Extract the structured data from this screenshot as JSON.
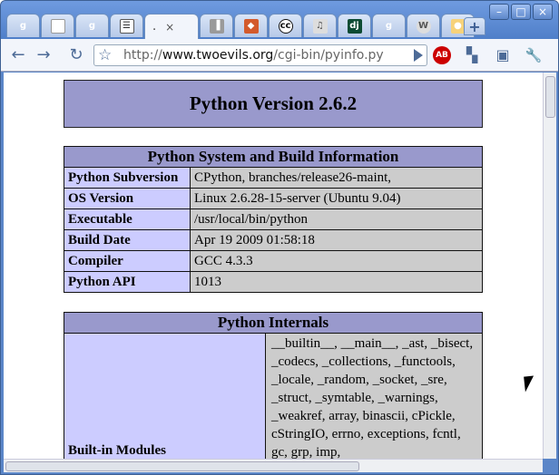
{
  "window": {
    "minimize": "–",
    "maximize": "□",
    "close": "×"
  },
  "tabs": [
    {
      "icon": "google-icon",
      "text": "g",
      "color": "#4285f4"
    },
    {
      "icon": "blank-page-icon",
      "text": "",
      "color": "#cccccc"
    },
    {
      "icon": "google-icon",
      "text": "g",
      "color": "#4285f4"
    },
    {
      "icon": "document-icon",
      "text": "☰",
      "color": "#444444"
    },
    {
      "title": ".",
      "close": "×",
      "active": true
    },
    {
      "icon": "bar-icon",
      "text": "▐",
      "color": "#777777"
    },
    {
      "icon": "face-icon",
      "text": "◆",
      "color": "#d35a2c"
    },
    {
      "icon": "creative-commons-icon",
      "text": "cc",
      "color": "#222222"
    },
    {
      "icon": "ghost-icon",
      "text": "♫",
      "color": "#888888"
    },
    {
      "icon": "django-icon",
      "text": "dj",
      "color": "#0c4b33"
    },
    {
      "icon": "google-icon",
      "text": "g",
      "color": "#4285f4"
    },
    {
      "icon": "wordpress-icon",
      "text": "W",
      "color": "#777777"
    },
    {
      "icon": "gold-circle-icon",
      "text": "●",
      "color": "#f0a23a"
    }
  ],
  "newtab": "+",
  "toolbar": {
    "back": "←",
    "forward": "→",
    "reload": "↻",
    "bookmark": "☆",
    "page_menu": "▣",
    "wrench": "🔧",
    "adblock_badge": "AB"
  },
  "url": {
    "scheme": "http://",
    "host": "www.twoevils.org",
    "path": "/cgi-bin/pyinfo.py"
  },
  "page": {
    "heading": "Python Version 2.6.2",
    "build_info": {
      "title": "Python System and Build Information",
      "rows": [
        {
          "k": "Python Subversion",
          "v": "CPython, branches/release26-maint,"
        },
        {
          "k": "OS Version",
          "v": "Linux 2.6.28-15-server (Ubuntu 9.04)"
        },
        {
          "k": "Executable",
          "v": "/usr/local/bin/python"
        },
        {
          "k": "Build Date",
          "v": "Apr 19 2009 01:58:18"
        },
        {
          "k": "Compiler",
          "v": "GCC 4.3.3"
        },
        {
          "k": "Python API",
          "v": "1013"
        }
      ]
    },
    "internals": {
      "title": "Python Internals",
      "module_label": "Built-in Modules",
      "modules": "__builtin__, __main__, _ast, _bisect, _codecs, _collections, _functools, _locale, _random, _socket, _sre, _struct, _symtable, _warnings, _weakref, array, binascii, cPickle, cStringIO, errno, exceptions, fcntl, gc, grp, imp,"
    }
  }
}
